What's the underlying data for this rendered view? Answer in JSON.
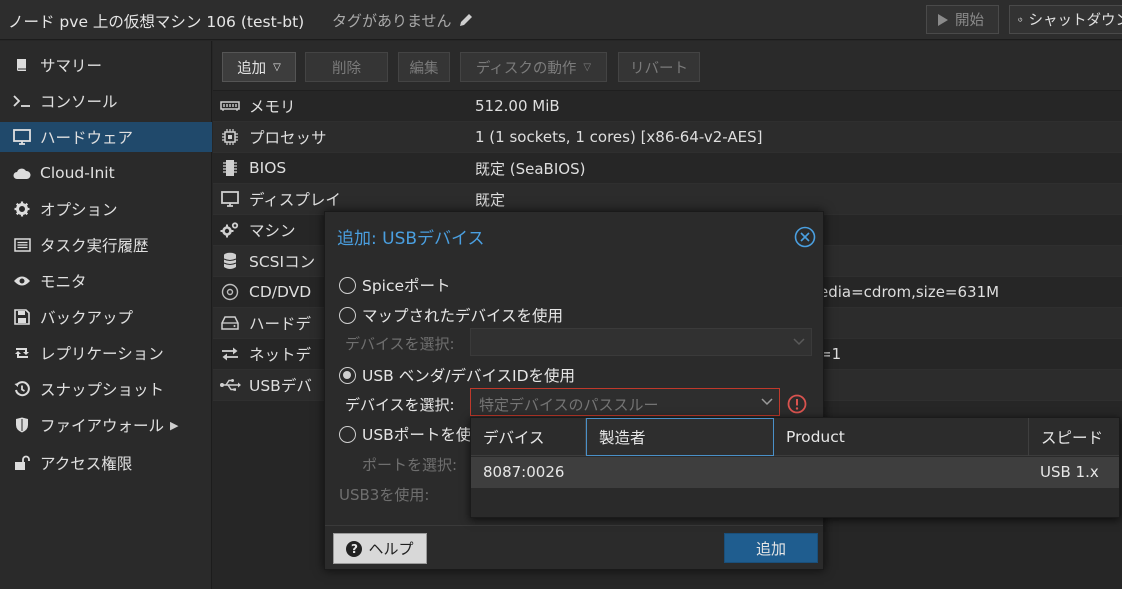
{
  "header": {
    "title": "ノード pve 上の仮想マシン 106 (test-bt)",
    "tags": "タグがありません",
    "start_label": "開始",
    "shutdown_label": "シャットダウン"
  },
  "sidebar": {
    "items": [
      {
        "label": "サマリー",
        "icon": "book-icon"
      },
      {
        "label": "コンソール",
        "icon": "terminal-icon"
      },
      {
        "label": "ハードウェア",
        "icon": "monitor-icon"
      },
      {
        "label": "Cloud-Init",
        "icon": "cloud-icon"
      },
      {
        "label": "オプション",
        "icon": "gear-icon"
      },
      {
        "label": "タスク実行履歴",
        "icon": "list-icon"
      },
      {
        "label": "モニタ",
        "icon": "eye-icon"
      },
      {
        "label": "バックアップ",
        "icon": "floppy-icon"
      },
      {
        "label": "レプリケーション",
        "icon": "retweet-icon"
      },
      {
        "label": "スナップショット",
        "icon": "history-icon"
      },
      {
        "label": "ファイアウォール",
        "icon": "shield-icon"
      },
      {
        "label": "アクセス権限",
        "icon": "unlock-icon"
      }
    ],
    "active_index": 2
  },
  "toolbar": {
    "add_label": "追加",
    "delete_label": "削除",
    "edit_label": "編集",
    "disk_action_label": "ディスクの動作",
    "revert_label": "リバート"
  },
  "hardware": {
    "rows": [
      {
        "name": "メモリ",
        "value": "512.00 MiB",
        "icon": "memory-icon"
      },
      {
        "name": "プロセッサ",
        "value": "1 (1 sockets, 1 cores) [x86-64-v2-AES]",
        "icon": "cpu-icon"
      },
      {
        "name": "BIOS",
        "value": "既定 (SeaBIOS)",
        "icon": "microchip-icon"
      },
      {
        "name": "ディスプレイ",
        "value": "既定",
        "icon": "desktop-icon"
      },
      {
        "name": "マシン",
        "value": "",
        "icon": "cogs-icon"
      },
      {
        "name": "SCSIコン",
        "value": "",
        "icon": "database-icon"
      },
      {
        "name": "CD/DVD",
        "value": "edia=cdrom,size=631M",
        "icon": "cdrom-icon"
      },
      {
        "name": "ハードデ",
        "value": "",
        "icon": "hdd-icon"
      },
      {
        "name": "ネットデ",
        "value": "=1",
        "icon": "exchange-icon"
      },
      {
        "name": "USBデバ",
        "value": "",
        "icon": "usb-icon"
      }
    ]
  },
  "dialog": {
    "title": "追加: USBデバイス",
    "radio_spice": "Spiceポート",
    "radio_mapped": "マップされたデバイスを使用",
    "mapped_select_label": "デバイスを選択:",
    "radio_vendor": "USB ベンダ/デバイスIDを使用",
    "vendor_select_label": "デバイスを選択:",
    "vendor_select_placeholder": "特定デバイスのパススルー",
    "radio_port": "USBポートを使",
    "port_select_label": "ポートを選択:",
    "usb3_label": "USB3を使用:",
    "help_label": "ヘルプ",
    "add_label": "追加"
  },
  "picker": {
    "columns": [
      "デバイス",
      "製造者",
      "Product",
      "スピード"
    ],
    "rows": [
      {
        "device": "8087:0026",
        "vendor": "",
        "product": "",
        "speed": "USB 1.x"
      }
    ]
  },
  "colors": {
    "accent": "#4a9fe0",
    "active_nav": "#20496b",
    "primary_button": "#1f5d8f",
    "error": "#d9534f"
  }
}
